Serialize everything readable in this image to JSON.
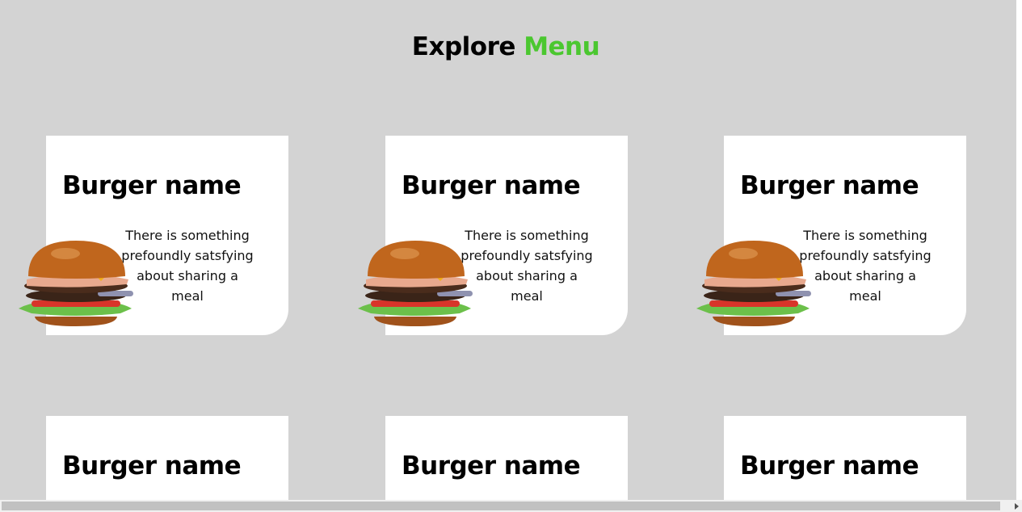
{
  "header": {
    "title_main": "Explore",
    "title_accent": "Menu",
    "accent_color": "#4bc730"
  },
  "cards": [
    {
      "name": "Burger name",
      "description": "There is something prefoundly satsfying about sharing a meal",
      "image": "burger-image"
    },
    {
      "name": "Burger name",
      "description": "There is something prefoundly satsfying about sharing a meal",
      "image": "burger-image"
    },
    {
      "name": "Burger name",
      "description": "There is something prefoundly satsfying about sharing a meal",
      "image": "burger-image"
    },
    {
      "name": "Burger name"
    },
    {
      "name": "Burger name"
    },
    {
      "name": "Burger name"
    }
  ]
}
